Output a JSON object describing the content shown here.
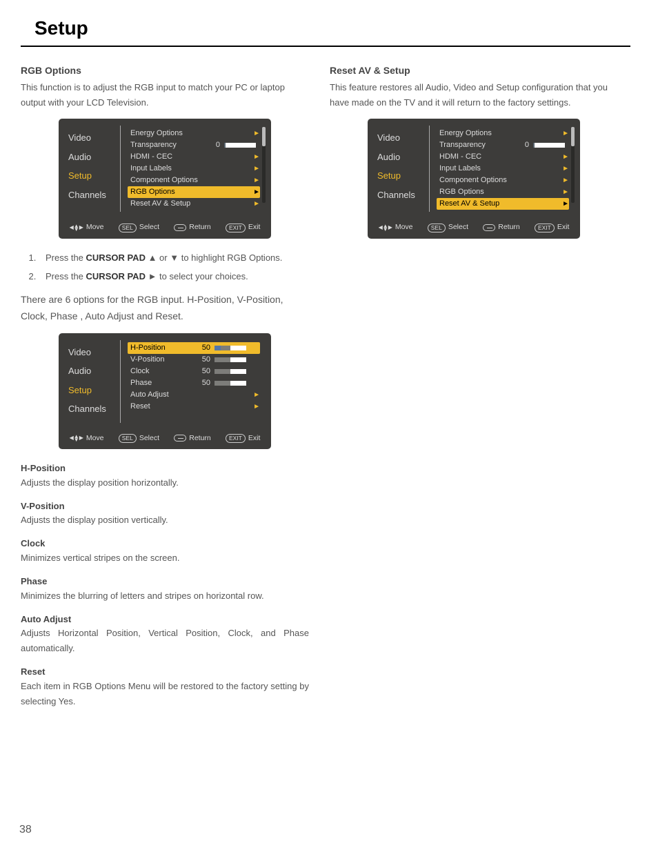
{
  "pageTitle": "Setup",
  "pageNumber": "38",
  "left": {
    "rgbOptions": {
      "heading": "RGB Options",
      "intro": "This function is to adjust the RGB input to match your PC or laptop output with your LCD Television.",
      "step1_prefix": "Press the ",
      "step1_bold": "CURSOR PAD",
      "step1_suffix": " ▲ or ▼ to highlight RGB Options.",
      "step2_prefix": "Press the ",
      "step2_bold": "CURSOR PAD",
      "step2_suffix": " ► to select your choices.",
      "afterList": "There are 6 options for the RGB input. H-Position, V-Position, Clock, Phase , Auto Adjust and Reset.",
      "descs": {
        "hpos_h": "H-Position",
        "hpos_t": "Adjusts the display position horizontally.",
        "vpos_h": "V-Position",
        "vpos_t": "Adjusts the display position vertically.",
        "clock_h": "Clock",
        "clock_t": "Minimizes vertical stripes on the screen.",
        "phase_h": "Phase",
        "phase_t": "Minimizes the blurring of letters and stripes on horizontal row.",
        "auto_h": "Auto Adjust",
        "auto_t": "Adjusts Horizontal Position, Vertical Position, Clock, and Phase automatically.",
        "reset_h": "Reset",
        "reset_t": "Each item in RGB Options Menu will be restored to the factory setting by selecting Yes."
      }
    }
  },
  "right": {
    "resetAv": {
      "heading": "Reset AV & Setup",
      "intro": "This feature restores all Audio, Video and Setup configuration that you have made on the TV and it will return to the factory settings."
    }
  },
  "osd": {
    "tabs": {
      "video": "Video",
      "audio": "Audio",
      "setup": "Setup",
      "channels": "Channels"
    },
    "setupItems": {
      "energy": "Energy Options",
      "transparency": "Transparency",
      "transparencyVal": "0",
      "hdmi": "HDMI - CEC",
      "inputLabels": "Input Labels",
      "component": "Component Options",
      "rgb": "RGB Options",
      "resetAv": "Reset AV & Setup"
    },
    "rgbItems": {
      "hpos": "H-Position",
      "vpos": "V-Position",
      "clock": "Clock",
      "phase": "Phase",
      "auto": "Auto Adjust",
      "reset": "Reset",
      "v50": "50"
    },
    "foot": {
      "move": "Move",
      "sel": "SEL",
      "select": "Select",
      "return": "Return",
      "exitCap": "EXIT",
      "exit": "Exit"
    }
  }
}
